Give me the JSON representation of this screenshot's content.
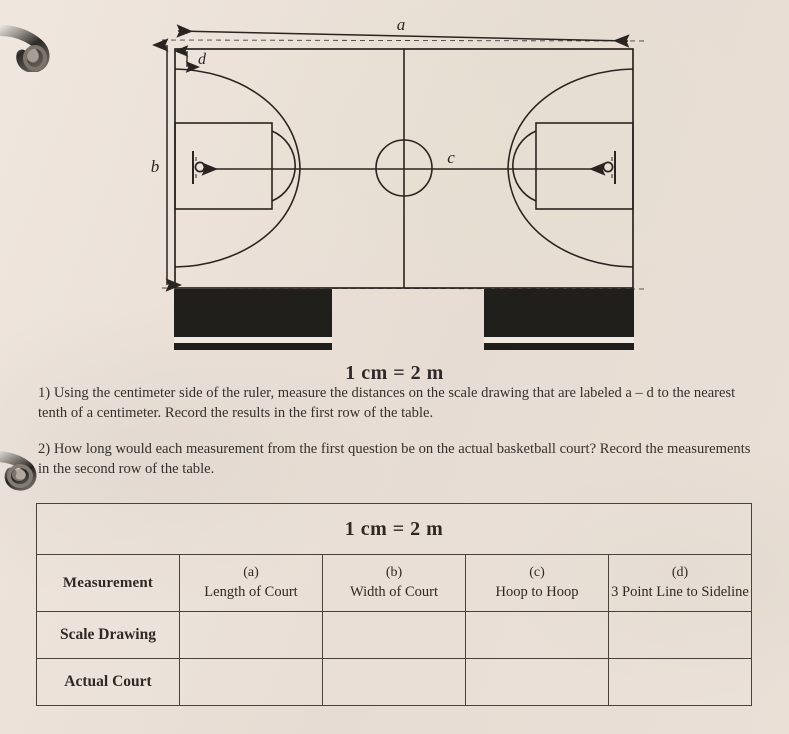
{
  "worksheet": {
    "scale_caption": "1 cm = 2 m",
    "questions": [
      {
        "number": "1)",
        "text": "Using the centimeter side of the ruler, measure the distances on the scale drawing that are labeled a – d to the nearest tenth of a centimeter.  Record the results in the first row of the table."
      },
      {
        "number": "2)",
        "text": "How long would each measurement from the first question be on the actual basketball court?  Record the measurements in the second row of the table."
      }
    ]
  },
  "diagram": {
    "labels": {
      "a": "a",
      "b": "b",
      "c": "c",
      "d": "d"
    },
    "description": "Scale drawing of a basketball court with dimension arrows",
    "line_color": "#2a2420",
    "bleacher_color": "#211f1b"
  },
  "table": {
    "scale_header": "1 cm = 2 m",
    "columns": [
      {
        "letter": "(a)",
        "name": "Length of Court"
      },
      {
        "letter": "(b)",
        "name": "Width of Court"
      },
      {
        "letter": "(c)",
        "name": "Hoop to Hoop"
      },
      {
        "letter": "(d)",
        "name": "3 Point Line to Sideline"
      }
    ],
    "rows": [
      {
        "label": "Measurement",
        "cells": [
          "",
          "",
          "",
          ""
        ]
      },
      {
        "label": "Scale Drawing",
        "cells": [
          "",
          "",
          "",
          ""
        ]
      },
      {
        "label": "Actual Court",
        "cells": [
          "",
          "",
          "",
          ""
        ]
      }
    ]
  },
  "colors": {
    "paper": "#e9ded5",
    "ink": "#2b2620",
    "rule": "#4a433c"
  }
}
